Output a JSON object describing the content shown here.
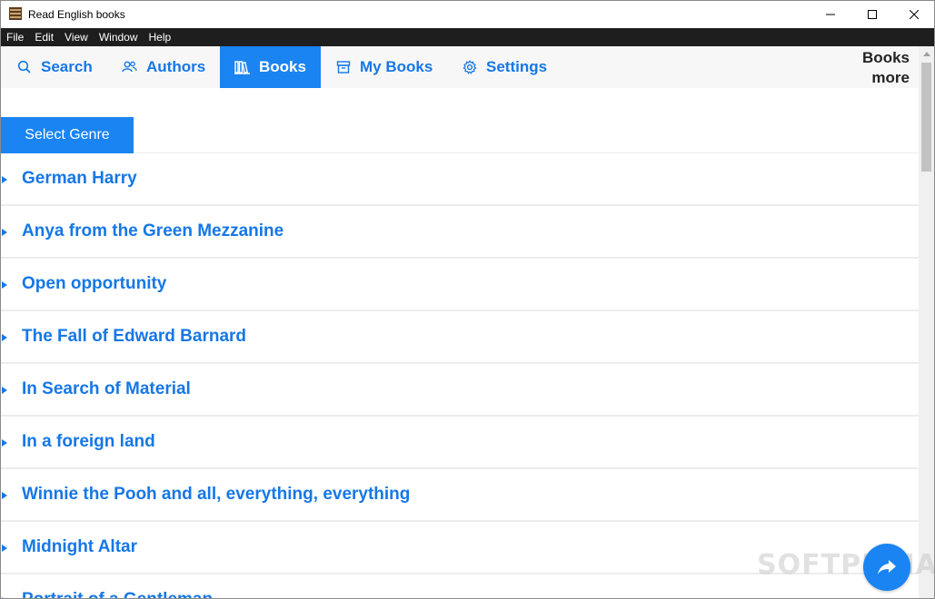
{
  "window": {
    "title": "Read English books",
    "icon": "books-app-icon"
  },
  "menu": {
    "items": [
      "File",
      "Edit",
      "View",
      "Window",
      "Help"
    ]
  },
  "tabs": [
    {
      "label": "Search",
      "icon": "search-icon",
      "active": false
    },
    {
      "label": "Authors",
      "icon": "authors-icon",
      "active": false
    },
    {
      "label": "Books",
      "icon": "books-icon",
      "active": true
    },
    {
      "label": "My Books",
      "icon": "my-books-icon",
      "active": false
    },
    {
      "label": "Settings",
      "icon": "gear-icon",
      "active": false
    }
  ],
  "books_more": {
    "line1": "Books",
    "line2": "more"
  },
  "genre_button": "Select Genre",
  "books": [
    "German Harry",
    "Anya from the Green Mezzanine",
    "Open opportunity",
    "The Fall of Edward Barnard",
    "In Search of Material",
    "In a foreign land",
    "Winnie the Pooh and all, everything, everything",
    "Midnight Altar",
    "Portrait of a Gentleman"
  ],
  "watermark": "SOFTPEDIA",
  "colors": {
    "accent": "#1a84f2",
    "link": "#1677e6",
    "menubar": "#1e1e1e"
  }
}
